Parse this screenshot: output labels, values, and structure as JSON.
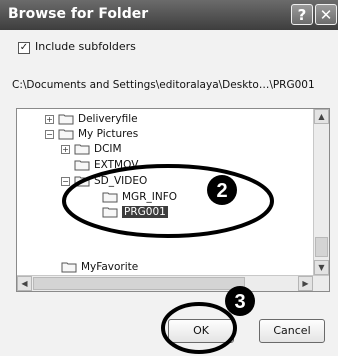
{
  "window": {
    "title": "Browse for Folder",
    "help_glyph": "?",
    "close_glyph": "✕"
  },
  "checkbox": {
    "label": "Include subfolders",
    "checked": true
  },
  "path": "C:\\Documents and Settings\\editoralaya\\Deskto…\\PRG001",
  "tree": [
    {
      "label": "Deliveryfile",
      "expander": "+"
    },
    {
      "label": "My Pictures",
      "expander": "−"
    },
    {
      "label": "DCIM",
      "expander": "+"
    },
    {
      "label": "EXTMOV",
      "expander": ""
    },
    {
      "label": "SD_VIDEO",
      "expander": "−"
    },
    {
      "label": "MGR_INFO",
      "expander": ""
    },
    {
      "label": "PRG001",
      "expander": "",
      "selected": true
    },
    {
      "label": "MyFavorite",
      "expander": ""
    }
  ],
  "buttons": {
    "ok": "OK",
    "cancel": "Cancel"
  },
  "callouts": {
    "two": "2",
    "three": "3"
  }
}
